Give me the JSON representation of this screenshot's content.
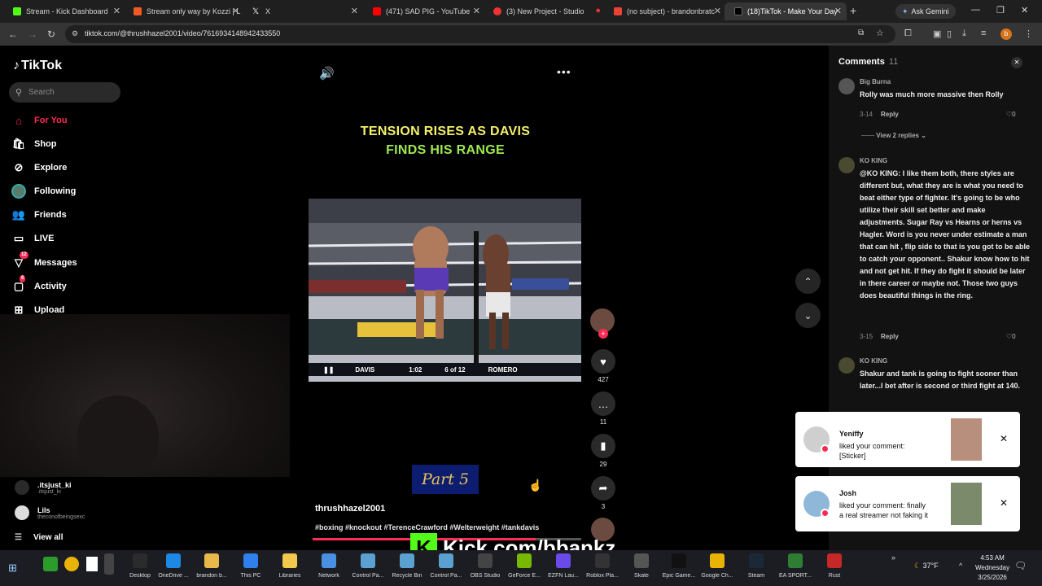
{
  "browser": {
    "tabs": [
      {
        "title": "Stream - Kick Dashboard",
        "color": "#53fc18"
      },
      {
        "title": "Stream only way by Kozzi | L",
        "color": "#f15a24"
      },
      {
        "title": "X",
        "color": "#ffffff"
      },
      {
        "title": "(471) SAD PIG - YouTube",
        "color": "#ff0000"
      },
      {
        "title": "(3) New Project - Studio",
        "color": "#e33"
      },
      {
        "title": "(no subject) - brandonbratc",
        "color": "#ea4335"
      },
      {
        "title": "(18)TikTok - Make Your Day",
        "color": "#ffffff"
      }
    ],
    "ask_gemini": "Ask Gemini",
    "url": "tiktok.com/@thrushhazel2001/video/7616934148942433550",
    "profile_initial": "b"
  },
  "sidebar": {
    "logo": "TikTok",
    "search_placeholder": "Search",
    "nav": [
      {
        "label": "For You",
        "icon": "home-icon"
      },
      {
        "label": "Shop",
        "icon": "shop-icon"
      },
      {
        "label": "Explore",
        "icon": "compass-icon"
      },
      {
        "label": "Following",
        "icon": "following-icon"
      },
      {
        "label": "Friends",
        "icon": "friends-icon"
      },
      {
        "label": "LIVE",
        "icon": "live-icon"
      },
      {
        "label": "Messages",
        "icon": "messages-icon",
        "badge": "12"
      },
      {
        "label": "Activity",
        "icon": "activity-icon",
        "badge": "6"
      },
      {
        "label": "Upload",
        "icon": "upload-icon"
      }
    ],
    "following_accounts": [
      {
        "name": ".itsjust_ki",
        "handle": ".itsjust_ki"
      },
      {
        "name": "Lils",
        "handle": "theconofbeingsexc"
      }
    ],
    "view_all": "View all"
  },
  "video": {
    "headline_line1": "TENSION RISES AS DAVIS",
    "headline_line2": "FINDS HIS RANGE",
    "scoreboard": {
      "fighter_left": "DAVIS",
      "time": "1:02",
      "round": "6 of 12",
      "fighter_right": "ROMERO"
    },
    "part_label": "Part 5",
    "username": "thrushhazel2001",
    "hashtags": "#boxing #knockout #TerenceCrawford #Welterweight #tankdavis",
    "progress_fraction": 0.83
  },
  "actions": {
    "likes": "427",
    "comments": "11",
    "saves": "29",
    "shares": "3"
  },
  "comments_panel": {
    "title": "Comments",
    "count": "11",
    "items": [
      {
        "author": "Big Burna",
        "text": "Rolly was much more massive then Rolly",
        "date": "3-14",
        "reply": "Reply",
        "likes": "0"
      },
      {
        "author": "KO KING",
        "text": "@KO KING: I like them both, there styles are different but, what they are is what you need to beat either type of fighter. It's going to be who utilize their skill set better and make adjustments. Sugar Ray vs Hearns or herns vs Hagler. Word is you never under estimate a man that can hit , flip side to that is you got to be able to catch your opponent.. Shakur know how to hit and not get hit. If they do fight it should be later in there career or maybe not. Those two guys does beautiful things in the ring.",
        "date": "3-15",
        "reply": "Reply",
        "likes": "0"
      },
      {
        "author": "KO KING",
        "text": "Shakur and tank is going to fight sooner than later...I bet after is second or third fight at 140."
      }
    ],
    "view_replies": "View 2 replies"
  },
  "notifications": [
    {
      "name": "Yeniffy",
      "message": "liked your comment: [Sticker]"
    },
    {
      "name": "Josh",
      "message": "liked your comment: finally a real streamer not faking it"
    }
  ],
  "overlay": {
    "kick_text": "Kick.com/bbankz",
    "kick_letter": "K"
  },
  "taskbar": {
    "items": [
      "Desktop",
      "OneDrive ...",
      "brandon b...",
      "This PC",
      "Libraries",
      "Network",
      "Control Pa...",
      "Recycle Bin",
      "Control Pa...",
      "OBS Studio",
      "GeForce E...",
      "EZFN Lau...",
      "Roblox Pla...",
      "Skate",
      "Epic Game...",
      "Google Ch...",
      "Steam",
      "EA SPORT...",
      "Rust"
    ],
    "weather": "37°F",
    "time": "4:53 AM",
    "day": "Wednesday",
    "date": "3/25/2026"
  }
}
